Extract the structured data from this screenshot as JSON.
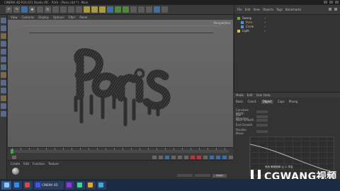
{
  "titlebar": {
    "title": "CINEMA 4D R16.021 Studio (RC - R16) - [Paris.c4d *] - Main"
  },
  "viewport": {
    "menu": [
      "View",
      "Cameras",
      "Display",
      "Options",
      "Filter",
      "Panel"
    ],
    "label": "Perspective"
  },
  "materials": {
    "tabs": [
      "Create",
      "Edit",
      "Function",
      "Texture"
    ],
    "mat_name": "Mat"
  },
  "transport": {
    "apply_label": "Apply"
  },
  "object_manager": {
    "menu": [
      "File",
      "Edit",
      "View",
      "Objects",
      "Tags",
      "Bookmarks"
    ],
    "rows": [
      {
        "name": "Sweep",
        "selected": false
      },
      {
        "name": "Paris",
        "selected": true
      },
      {
        "name": "Circle",
        "selected": false
      },
      {
        "name": "Light",
        "selected": false
      }
    ]
  },
  "attributes": {
    "tabs": [
      "Mode",
      "Edit",
      "User Data"
    ],
    "subtabs": [
      "Basic",
      "Coord.",
      "Object",
      "Caps",
      "Phong"
    ],
    "active_subtab": "Object",
    "fields": [
      {
        "label": "Constant Width"
      },
      {
        "label": "Rail Direction"
      },
      {
        "label": "Start Growth"
      },
      {
        "label": "End Growth"
      },
      {
        "label": "Parallel Move"
      }
    ]
  },
  "watermark": {
    "text": "CGWANG视频",
    "subtitle": "系统 教程视频 让 人 学会"
  },
  "taskbar": {
    "items": [
      {
        "label": "",
        "color": "#3a8ad8"
      },
      {
        "label": "",
        "color": "#d84a3a"
      },
      {
        "label": "CINEMA 4D",
        "color": "#3a5ad8"
      },
      {
        "label": "",
        "color": "#8a3ad8"
      },
      {
        "label": "",
        "color": "#3ad88a"
      },
      {
        "label": "",
        "color": "#d8a83a"
      },
      {
        "label": "",
        "color": "#3aa8d8"
      }
    ]
  }
}
